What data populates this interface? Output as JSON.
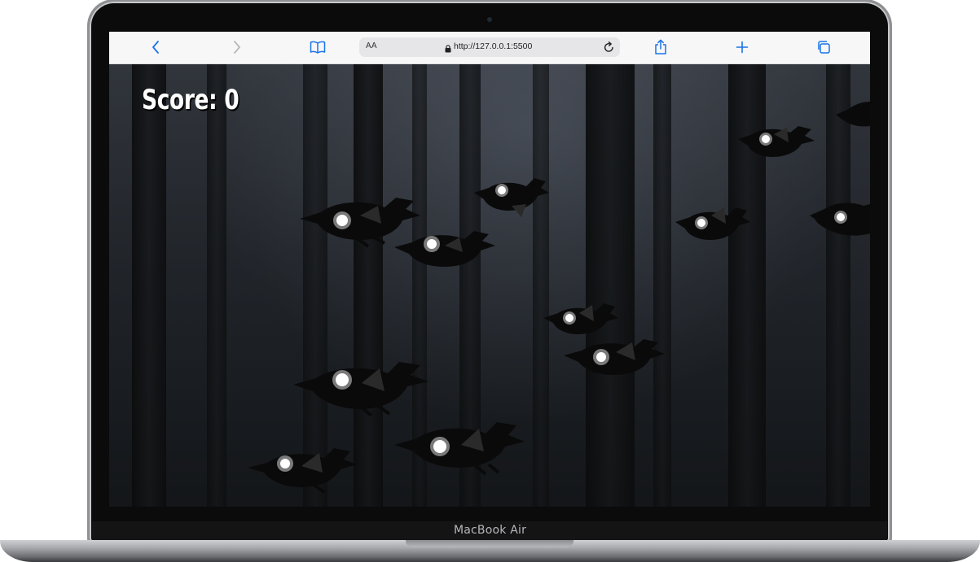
{
  "device": {
    "label": "MacBook Air"
  },
  "browser": {
    "text_size_label": "AA",
    "url": "http://127.0.0.1:5500"
  },
  "game": {
    "score_label": "Score: 0",
    "score": 0
  },
  "icons": [
    "back-icon",
    "forward-icon",
    "bookmarks-icon",
    "lock-icon",
    "reload-icon",
    "share-icon",
    "new-tab-icon",
    "tabs-icon"
  ],
  "colors": {
    "accent": "#1a73e8",
    "raven": "#0a0a0a",
    "eye": "#ffffff"
  }
}
